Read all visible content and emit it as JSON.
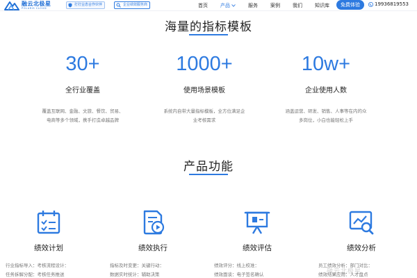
{
  "header": {
    "logo": {
      "name_cn": "融云北极星",
      "name_en": "POLARIS CLOUD",
      "icon": "polaris-logo-icon"
    },
    "slogan_badge": "打打业态合作伙伴",
    "service_badge": "企业绩效服务商",
    "nav": [
      {
        "label": "首页",
        "active": false
      },
      {
        "label": "产品",
        "active": true,
        "has_dropdown": true
      },
      {
        "label": "服务",
        "active": false
      },
      {
        "label": "案例",
        "active": false
      },
      {
        "label": "我们",
        "active": false
      },
      {
        "label": "知识库",
        "active": false
      }
    ],
    "trial_button": "免费体验",
    "phone": "19936819553",
    "accent_color": "#2d7ae0"
  },
  "templates_section": {
    "title": "海量的指标模板",
    "stats": [
      {
        "value": "30+",
        "label": "全行业覆盖",
        "desc": [
          "覆盖互联网、金融、文旅、餐饮、贸易、",
          "电商等多个领域，携手打造卓越品牌"
        ]
      },
      {
        "value": "1000+",
        "label": "使用场景模板",
        "desc": [
          "系统内自带大量指标模板，全方位满足企",
          "业考核需求"
        ]
      },
      {
        "value": "10w+",
        "label": "企业使用人数",
        "desc": [
          "涵盖运营、研发、销售、人事等在内的众",
          "多岗位，小白也能轻松上手"
        ]
      }
    ]
  },
  "features_section": {
    "title": "产品功能",
    "features": [
      {
        "icon": "calendar-checklist-icon",
        "title": "绩效计划",
        "desc": [
          "行业指标导入：考核流程设计：",
          "任务拆解分配：考核任务推送"
        ]
      },
      {
        "icon": "document-play-icon",
        "title": "绩效执行",
        "desc": [
          "指标及时变更：关键行动：",
          "数据实时统计：辅助决策"
        ]
      },
      {
        "icon": "presentation-board-icon",
        "title": "绩效评估",
        "desc": [
          "绩效评分：线上校准：",
          "绩效面谈：电子签名确认"
        ]
      },
      {
        "icon": "chart-magnifier-icon",
        "title": "绩效分析",
        "desc": [
          "员工绩效分析：部门对比：",
          "绩效结果应用：人才盘点"
        ]
      }
    ]
  },
  "watermark": "融云北极星"
}
